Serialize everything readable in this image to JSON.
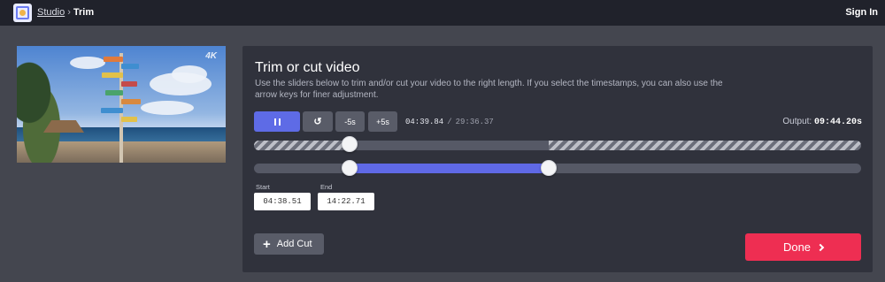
{
  "topbar": {
    "breadcrumb_studio": "Studio",
    "breadcrumb_separator": "›",
    "breadcrumb_current": "Trim",
    "signin_label": "Sign In"
  },
  "thumbnail": {
    "badge": "4K"
  },
  "editor": {
    "title": "Trim or cut video",
    "description": "Use the sliders below to trim and/or cut your video to the right length. If you select the timestamps, you can also use the arrow keys for finer adjustment.",
    "controls": {
      "pause_icon": "pause-icon",
      "replay_icon": "replay-icon",
      "replay_glyph": "↺",
      "minus5_label": "-5s",
      "plus5_label": "+5s"
    },
    "current_time": "04:39.84",
    "time_separator": "/",
    "duration": "29:36.37",
    "output_label": "Output:",
    "output_value": "09:44.20s",
    "trim": {
      "start_fraction": 0.158,
      "end_fraction": 0.486,
      "playhead_fraction": 0.158
    },
    "start_label": "Start",
    "start_value": "04:38.51",
    "end_label": "End",
    "end_value": "14:22.71",
    "add_cut_icon": "plus-icon",
    "add_cut_label": "Add Cut",
    "done_label": "Done"
  },
  "colors": {
    "accent": "#5e6be6",
    "done": "#ee2e52",
    "topbar": "#20222b",
    "card": "#30323c"
  }
}
